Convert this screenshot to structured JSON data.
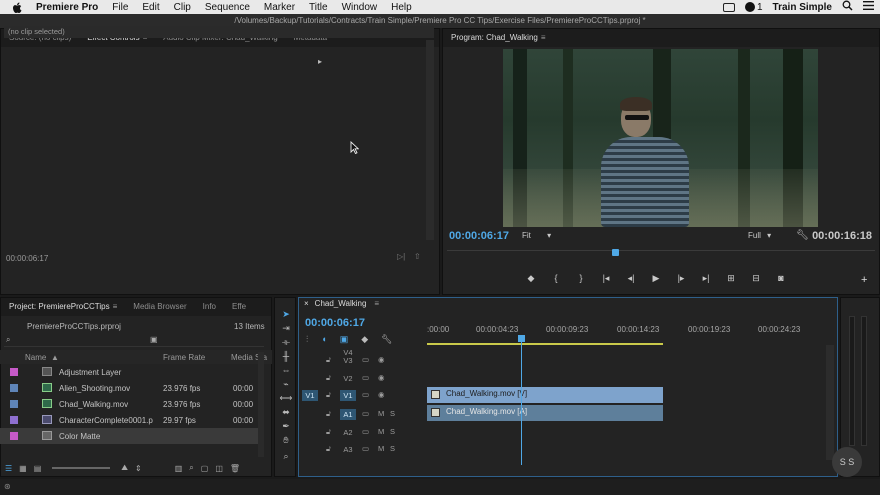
{
  "menubar": {
    "app": "Premiere Pro",
    "items": [
      "File",
      "Edit",
      "Clip",
      "Sequence",
      "Marker",
      "Title",
      "Window",
      "Help"
    ],
    "badge": "1",
    "user": "Train Simple"
  },
  "path": "/Volumes/Backup/Tutorials/Contracts/Train Simple/Premiere Pro CC Tips/Exercise Files/PremiereProCCTips.prproj *",
  "source_panel": {
    "tabs": [
      "Source: (no clips)",
      "Effect Controls",
      "Audio Clip Mixer: Chad_Walking",
      "Metadata"
    ],
    "active_tab": "Effect Controls",
    "no_clip": "(no clip selected)",
    "timecode": "00:00:06:17"
  },
  "program_panel": {
    "title": "Program: Chad_Walking",
    "timecode": "00:00:06:17",
    "fit": "Fit",
    "resolution": "Full",
    "duration": "00:00:16:18",
    "transport_icons": [
      "marker-icon",
      "in-point-icon",
      "out-point-icon",
      "go-to-in-icon",
      "step-back-icon",
      "play-icon",
      "step-forward-icon",
      "go-to-out-icon",
      "lift-icon",
      "extract-icon",
      "export-frame-icon",
      "add-button-icon"
    ]
  },
  "project_panel": {
    "tabs": [
      "Project: PremiereProCCTips",
      "Media Browser",
      "Info",
      "Effe"
    ],
    "project_file": "PremiereProCCTips.prproj",
    "item_count": "13 Items",
    "columns": [
      "Name",
      "Frame Rate",
      "Media Sta"
    ],
    "items": [
      {
        "name": "Adjustment Layer",
        "fps": "",
        "start": "",
        "color": "#c65ac8"
      },
      {
        "name": "Alien_Shooting.mov",
        "fps": "23.976 fps",
        "start": "00:00",
        "color": "#5f85b8"
      },
      {
        "name": "Chad_Walking.mov",
        "fps": "23.976 fps",
        "start": "00:00",
        "color": "#5f85b8"
      },
      {
        "name": "CharacterComplete0001.p",
        "fps": "29.97 fps",
        "start": "00:00",
        "color": "#8e6fd0"
      },
      {
        "name": "Color Matte",
        "fps": "",
        "start": "",
        "color": "#c65ac8"
      }
    ]
  },
  "timeline": {
    "tab": "Chad_Walking",
    "timecode": "00:00:06:17",
    "ruler_labels": [
      ":00:00",
      "00:00:04:23",
      "00:00:09:23",
      "00:00:14:23",
      "00:00:19:23",
      "00:00:24:23"
    ],
    "tracks": [
      {
        "name": "V4",
        "kind": "video",
        "targeted": false,
        "source": ""
      },
      {
        "name": "V3",
        "kind": "video",
        "targeted": false,
        "source": ""
      },
      {
        "name": "V2",
        "kind": "video",
        "targeted": false,
        "source": ""
      },
      {
        "name": "V1",
        "kind": "video",
        "targeted": true,
        "source": "V1"
      },
      {
        "name": "A1",
        "kind": "audio",
        "targeted": true,
        "source": ""
      },
      {
        "name": "A2",
        "kind": "audio",
        "targeted": false,
        "source": ""
      },
      {
        "name": "A3",
        "kind": "audio",
        "targeted": false,
        "source": ""
      }
    ],
    "clips": {
      "video": "Chad_Walking.mov [V]",
      "audio": "Chad_Walking.mov [A]"
    },
    "mute": "M",
    "solo": "S"
  },
  "meters": {
    "labels": "S  S"
  },
  "colors": {
    "accent": "#4fa8e6",
    "workarea": "#c9c94a",
    "video_clip": "#7ea3cc",
    "audio_clip": "#5e7f9b"
  }
}
